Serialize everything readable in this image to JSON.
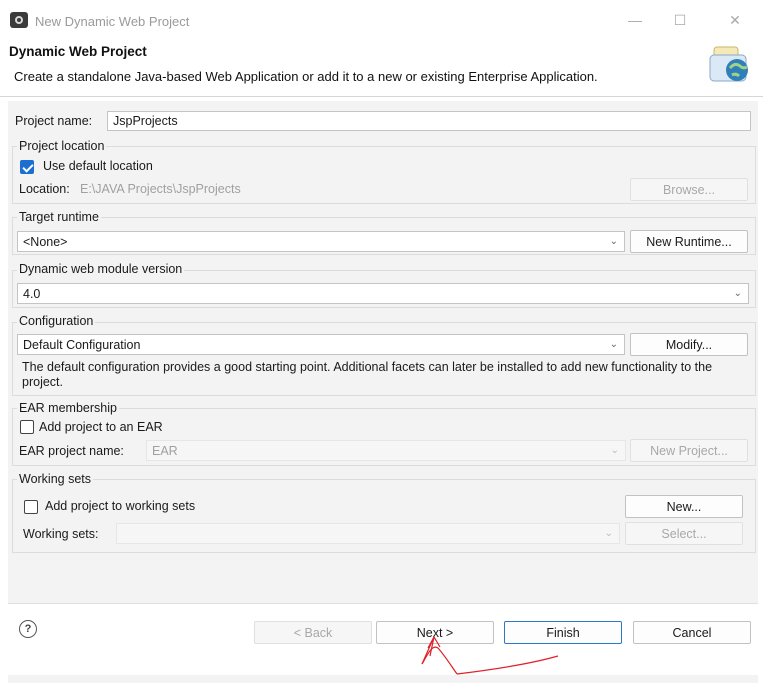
{
  "window": {
    "title": "New Dynamic Web Project",
    "controls": {
      "minimize": "—",
      "maximize": "☐",
      "close": "✕"
    }
  },
  "header": {
    "title": "Dynamic Web Project",
    "description": "Create a standalone Java-based Web Application or add it to a new or existing Enterprise Application."
  },
  "project": {
    "name_label": "Project name:",
    "name_value": "JspProjects"
  },
  "location": {
    "group_title": "Project location",
    "use_default_label": "Use default location",
    "use_default_checked": true,
    "location_label": "Location:",
    "location_value": "E:\\JAVA Projects\\JspProjects",
    "browse_label": "Browse..."
  },
  "runtime": {
    "group_title": "Target runtime",
    "selected": "<None>",
    "new_runtime_label": "New Runtime..."
  },
  "module": {
    "group_title": "Dynamic web module version",
    "selected": "4.0"
  },
  "configuration": {
    "group_title": "Configuration",
    "selected": "Default Configuration",
    "modify_label": "Modify...",
    "description": "The default configuration provides a good starting point. Additional facets can later be installed to add new functionality to the project."
  },
  "ear": {
    "group_title": "EAR membership",
    "add_label": "Add project to an EAR",
    "add_checked": false,
    "project_name_label": "EAR project name:",
    "project_name_value": "EAR",
    "new_project_label": "New Project..."
  },
  "working_sets": {
    "group_title": "Working sets",
    "add_label": "Add project to working sets",
    "add_checked": false,
    "new_label": "New...",
    "sets_label": "Working sets:",
    "select_label": "Select..."
  },
  "footer": {
    "help_icon": "?",
    "back_label": "< Back",
    "next_label": "Next >",
    "finish_label": "Finish",
    "cancel_label": "Cancel"
  },
  "colors": {
    "accent": "#1a6fd0",
    "annotation": "#e0202a"
  },
  "icons": {
    "app": "eclipse-icon",
    "banner": "web-project-wizard-icon",
    "help": "help-icon",
    "chevron": "chevron-down-icon"
  }
}
